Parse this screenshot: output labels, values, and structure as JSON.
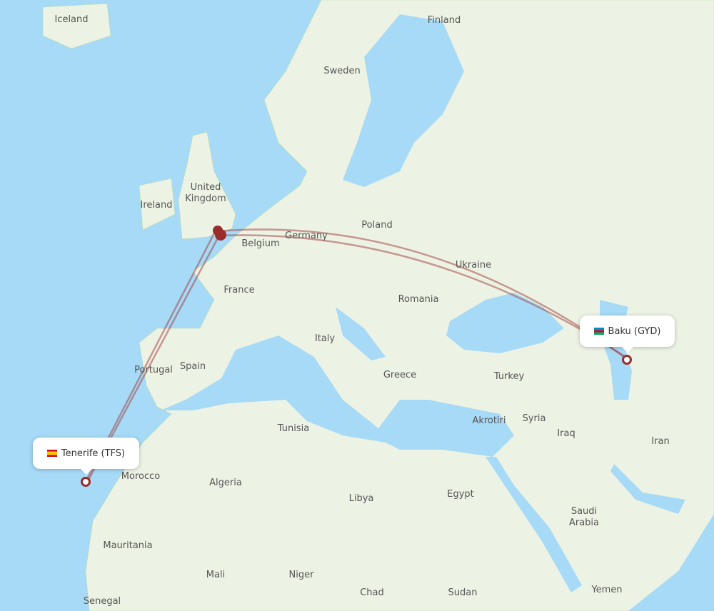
{
  "map": {
    "colors": {
      "ocean": "#a6daf6",
      "land": "#edf3e4",
      "route": "#a03c3c",
      "marker": "#9b2c2c"
    },
    "labels": [
      "Iceland",
      "Finland",
      "Sweden",
      "United Kingdom",
      "Ireland",
      "Poland",
      "Germany",
      "Belgium",
      "Ukraine",
      "France",
      "Romania",
      "Italy",
      "Portugal",
      "Spain",
      "Greece",
      "Turkey",
      "Tunisia",
      "Akrotiri",
      "Syria",
      "Iraq",
      "Iran",
      "Morocco",
      "Algeria",
      "Libya",
      "Egypt",
      "Saudi Arabia",
      "Mauritania",
      "Mali",
      "Niger",
      "Chad",
      "Sudan",
      "Yemen",
      "Senegal"
    ],
    "origin": {
      "label": "Tenerife (TFS)",
      "flag": "spain-flag-icon"
    },
    "destination": {
      "label": "Baku (GYD)",
      "flag": "azerbaijan-flag-icon"
    },
    "hub": "London"
  }
}
